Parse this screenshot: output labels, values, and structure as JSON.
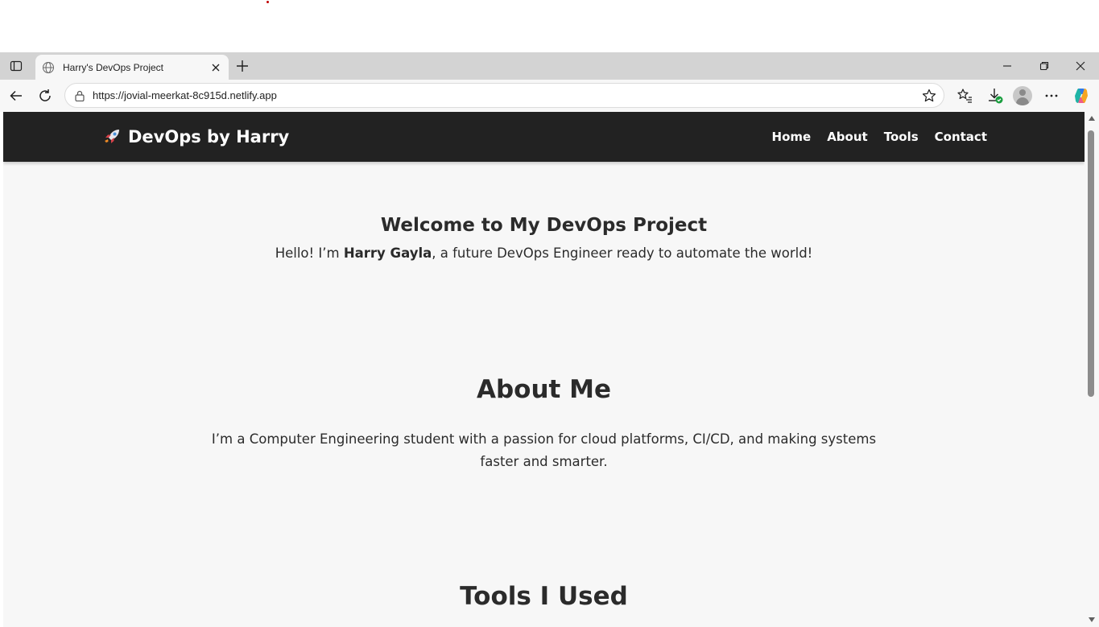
{
  "browser": {
    "tab_title": "Harry's DevOps Project",
    "url": "https://jovial-meerkat-8c915d.netlify.app",
    "icons": {
      "tab_actions": "tab-actions-icon",
      "favicon": "globe-icon",
      "tab_close": "close-icon",
      "new_tab": "plus-icon",
      "minimize": "minimize-icon",
      "restore": "restore-icon",
      "close_window": "close-icon",
      "back": "back-arrow-icon",
      "refresh": "refresh-icon",
      "lock": "lock-icon",
      "favorite": "star-icon",
      "favorites": "favorites-icon",
      "downloads": "download-icon",
      "profile": "avatar",
      "more": "more-icon",
      "copilot": "copilot-icon"
    }
  },
  "site": {
    "brand": "DevOps by Harry",
    "nav": [
      "Home",
      "About",
      "Tools",
      "Contact"
    ],
    "colors": {
      "nav_bg": "#222222",
      "page_bg": "#f7f7f7",
      "text": "#2b2b2b"
    }
  },
  "hero": {
    "title": "Welcome to My DevOps Project",
    "intro_before": "Hello! I’m ",
    "intro_name": "Harry Gayla",
    "intro_after": ", a future DevOps Engineer ready to automate the world!"
  },
  "about": {
    "title": "About Me",
    "text": "I’m a Computer Engineering student with a passion for cloud platforms, CI/CD, and making systems faster and smarter."
  },
  "tools": {
    "title": "Tools I Used"
  }
}
